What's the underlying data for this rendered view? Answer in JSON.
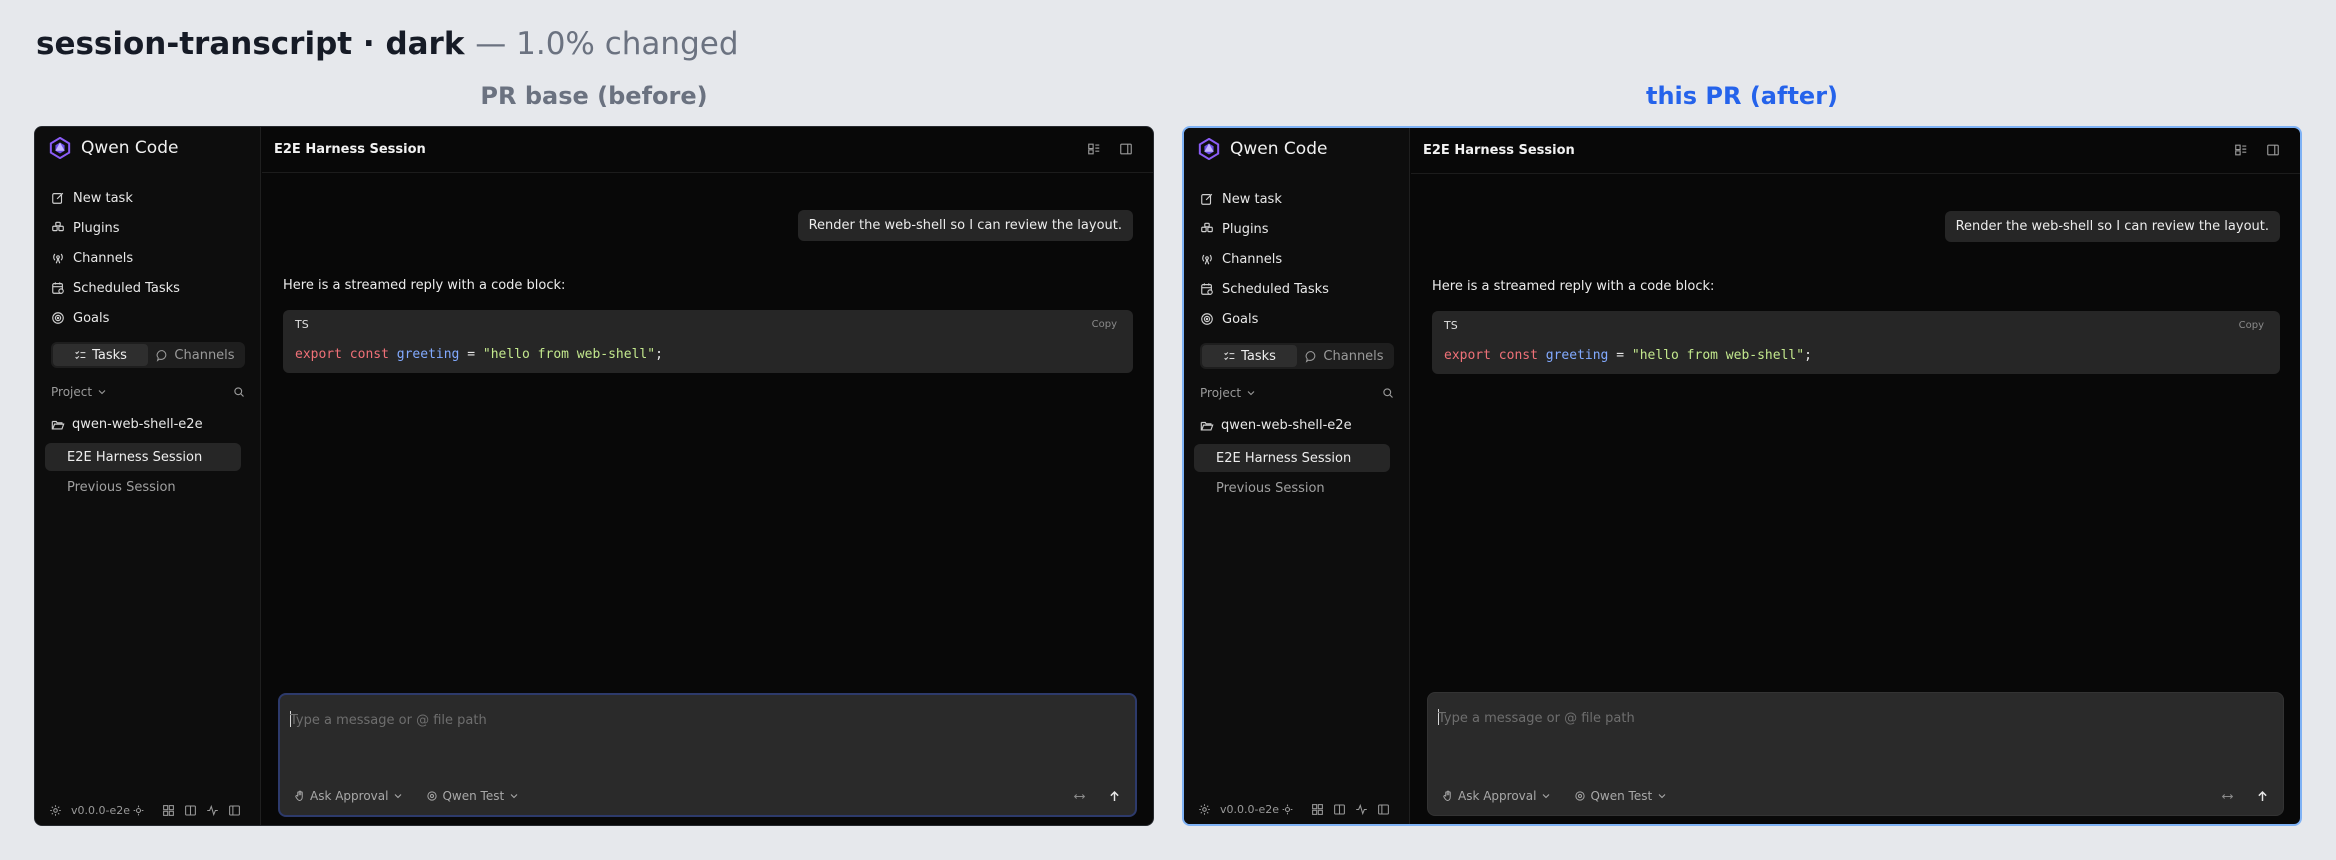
{
  "page": {
    "title": "session-transcript · dark",
    "subtitle": "— 1.0% changed"
  },
  "captions": {
    "before": "PR base (before)",
    "after": "this PR (after)"
  },
  "app": {
    "brand": "Qwen Code",
    "nav": [
      {
        "label": "New task",
        "icon": "edit-icon"
      },
      {
        "label": "Plugins",
        "icon": "plugin-icon"
      },
      {
        "label": "Channels",
        "icon": "antenna-icon"
      },
      {
        "label": "Scheduled Tasks",
        "icon": "calendar-clock-icon"
      },
      {
        "label": "Goals",
        "icon": "target-icon"
      }
    ],
    "segment": {
      "tasks": "Tasks",
      "channels": "Channels"
    },
    "project_label": "Project",
    "folder": "qwen-web-shell-e2e",
    "sessions": [
      "E2E Harness Session",
      "Previous Session"
    ],
    "version": "v0.0.0-e2e",
    "session_title": "E2E Harness Session",
    "user_message": "Render the web-shell so I can review the layout.",
    "reply_text": "Here is a streamed reply with a code block:",
    "code": {
      "lang": "TS",
      "copy_label": "Copy",
      "tokens": {
        "kw1": "export",
        "kw2": "const",
        "ident": "greeting",
        "op": " = ",
        "str": "\"hello from web-shell\"",
        "end": ";"
      }
    },
    "composer": {
      "placeholder": "Type a message or @ file path",
      "approval": "Ask Approval",
      "model": "Qwen Test"
    }
  },
  "colors": {
    "panel_bg": "#080808",
    "sidebar_bg": "#0d0d0d",
    "accent_blue": "#2563eb",
    "keyword": "#f07178",
    "identifier": "#82aaff",
    "string": "#c3e88d"
  }
}
